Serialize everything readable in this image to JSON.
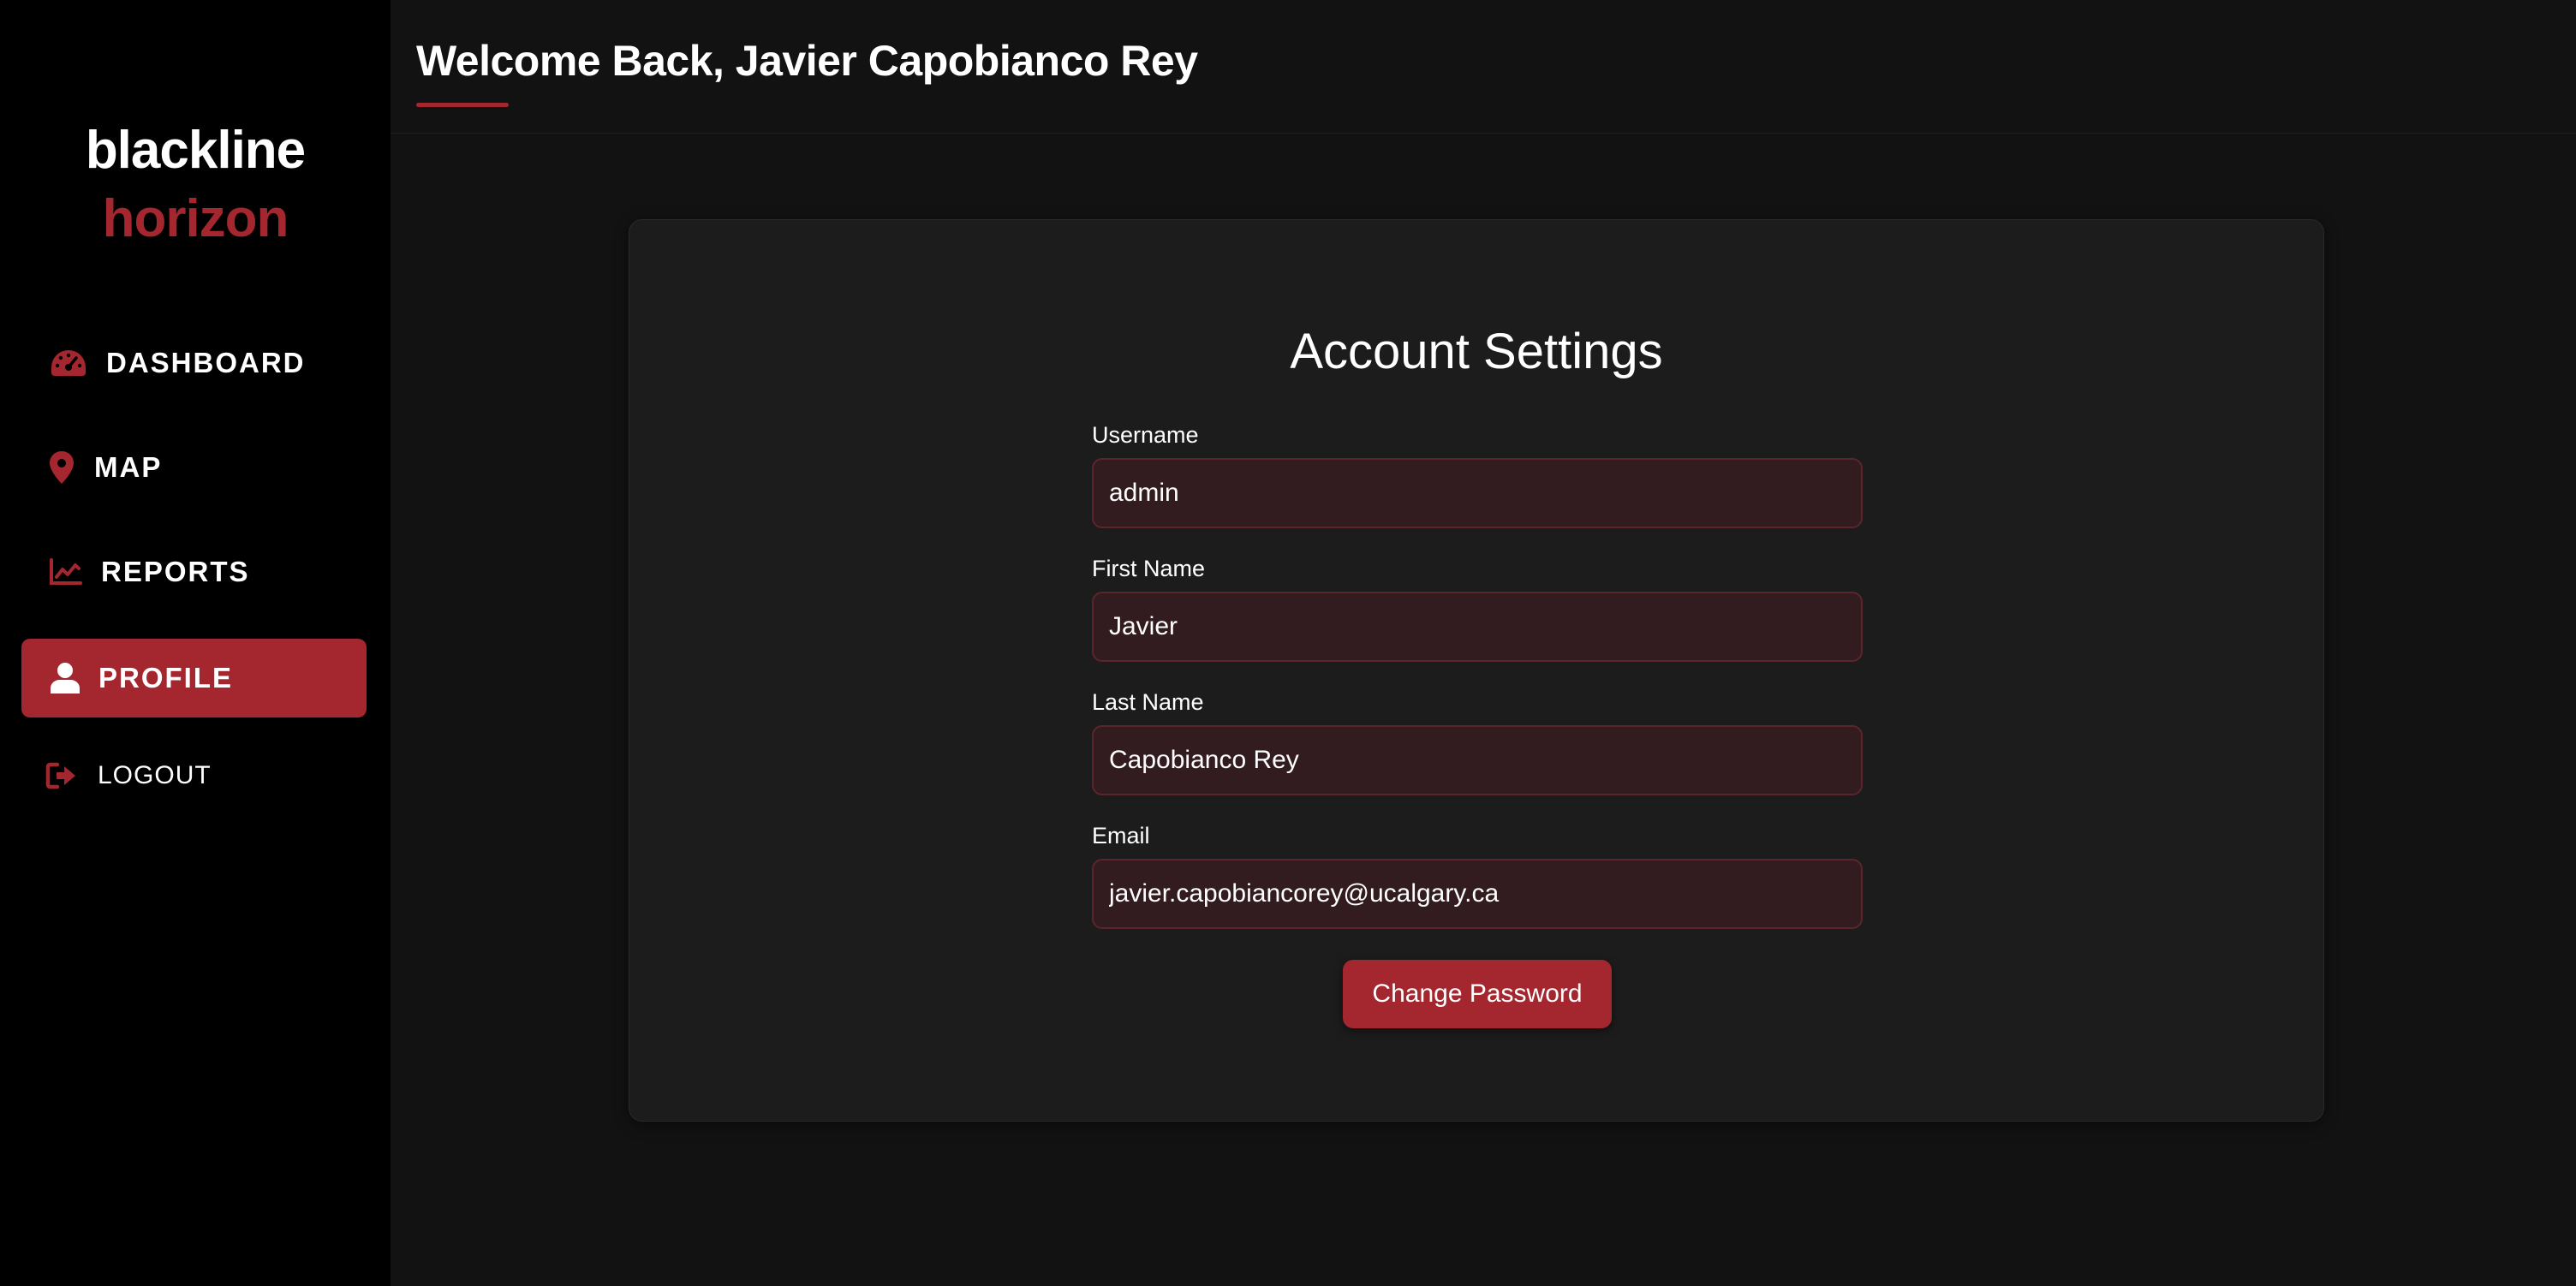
{
  "brand": {
    "line1": "blackline",
    "line2": "horizon"
  },
  "sidebar": {
    "items": [
      {
        "label": "DASHBOARD",
        "icon": "speedometer-icon",
        "active": false
      },
      {
        "label": "MAP",
        "icon": "map-pin-icon",
        "active": false
      },
      {
        "label": "REPORTS",
        "icon": "line-chart-icon",
        "active": false
      },
      {
        "label": "PROFILE",
        "icon": "user-icon",
        "active": true
      },
      {
        "label": "LOGOUT",
        "icon": "logout-icon",
        "active": false
      }
    ]
  },
  "header": {
    "title": "Welcome Back, Javier Capobianco Rey"
  },
  "account": {
    "title": "Account Settings",
    "fields": [
      {
        "label": "Username",
        "value": "admin"
      },
      {
        "label": "First Name",
        "value": "Javier"
      },
      {
        "label": "Last Name",
        "value": "Capobianco Rey"
      },
      {
        "label": "Email",
        "value": "javier.capobiancorey@ucalgary.ca"
      }
    ],
    "change_password_label": "Change Password"
  },
  "colors": {
    "accent": "#a4262f",
    "sidebar_bg": "#000000",
    "page_bg": "#121212",
    "card_bg": "#1c1c1c",
    "input_bg": "#331c1f"
  }
}
